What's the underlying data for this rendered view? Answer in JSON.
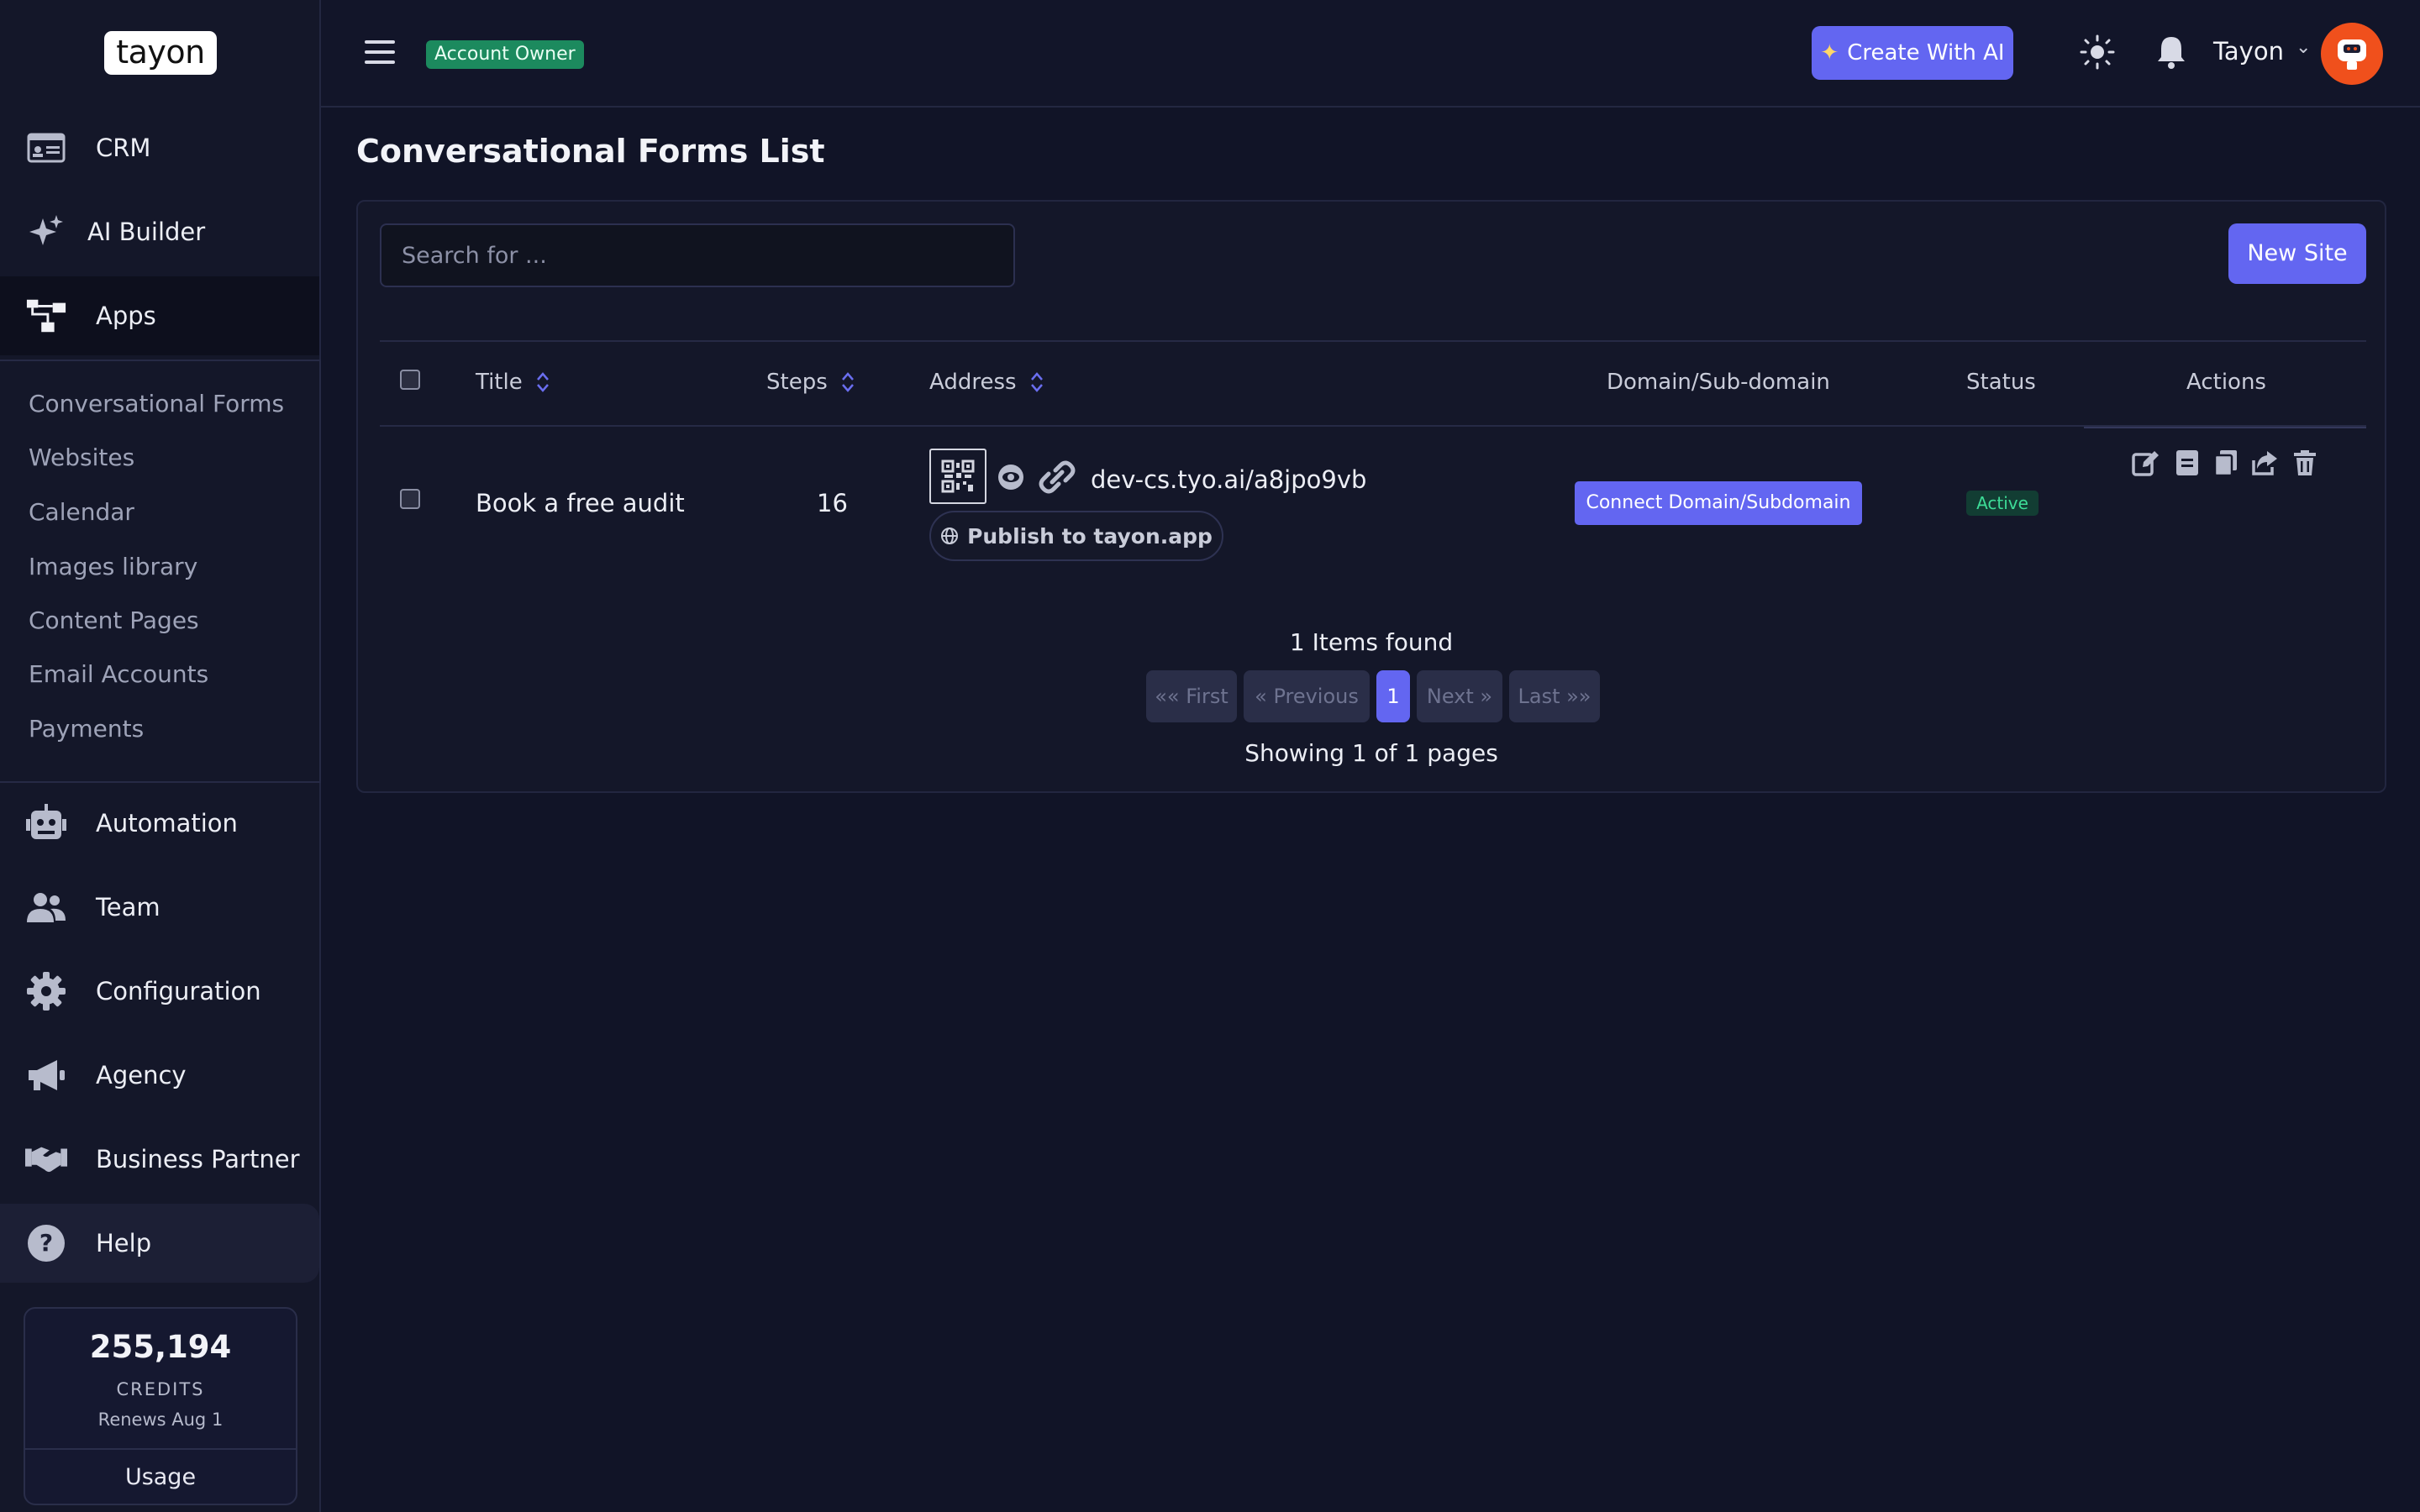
{
  "brand": {
    "logo_text": "tayon"
  },
  "sidebar": {
    "items": [
      {
        "label": "CRM",
        "icon": "id-card-icon"
      },
      {
        "label": "AI Builder",
        "icon": "sparkles-icon"
      },
      {
        "label": "Apps",
        "icon": "sitemap-icon"
      },
      {
        "label": "Automation",
        "icon": "robot-icon"
      },
      {
        "label": "Team",
        "icon": "users-icon"
      },
      {
        "label": "Configuration",
        "icon": "gear-icon"
      },
      {
        "label": "Agency",
        "icon": "megaphone-icon"
      },
      {
        "label": "Business Partner",
        "icon": "handshake-icon"
      },
      {
        "label": "Help",
        "icon": "question-circle-icon"
      }
    ],
    "apps_submenu": [
      "Conversational Forms",
      "Websites",
      "Calendar",
      "Images library",
      "Content Pages",
      "Email Accounts",
      "Payments"
    ],
    "credits": {
      "value": "255,194",
      "label": "CREDITS",
      "renews": "Renews Aug 1",
      "usage_label": "Usage"
    }
  },
  "topbar": {
    "role_badge": "Account Owner",
    "create_ai_label": "Create With AI",
    "user_name": "Tayon"
  },
  "main": {
    "title": "Conversational Forms List",
    "search_placeholder": "Search for ...",
    "new_site_label": "New Site",
    "table": {
      "headers": {
        "title": "Title",
        "steps": "Steps",
        "address": "Address",
        "domain": "Domain/Sub-domain",
        "status": "Status",
        "actions": "Actions"
      },
      "rows": [
        {
          "title": "Book a free audit",
          "steps": "16",
          "address": "dev-cs.tyo.ai/a8jpo9vb",
          "publish_label": "Publish to tayon.app",
          "connect_label": "Connect Domain/Subdomain",
          "status": "Active"
        }
      ]
    },
    "pagination": {
      "items_found": "1 Items found",
      "first": "«« First",
      "previous": "« Previous",
      "current": "1",
      "next": "Next »",
      "last": "Last »»",
      "showing": "Showing 1 of 1 pages"
    }
  },
  "colors": {
    "accent": "#6366f1",
    "background": "#111427",
    "success": "#1c8a5e",
    "active_text": "#3ddc97",
    "avatar": "#f0501c"
  }
}
